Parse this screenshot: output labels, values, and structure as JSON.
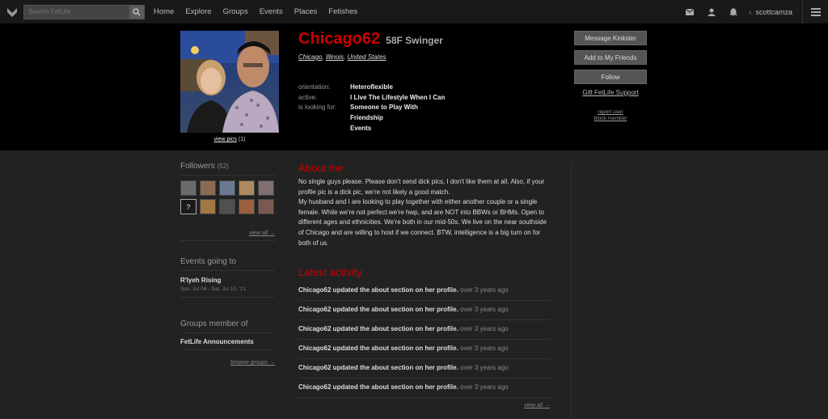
{
  "nav": {
    "search_placeholder": "Search FetLife",
    "links": [
      "Home",
      "Explore",
      "Groups",
      "Events",
      "Places",
      "Fetishes"
    ],
    "username": "scottcamza",
    "user_caret": "‹"
  },
  "profile": {
    "nickname": "Chicago62",
    "meta": "58F Swinger",
    "location": [
      "Chicago",
      "Illinois",
      "United States"
    ],
    "view_pics_label": "view pics",
    "pic_count": "(1)",
    "details": {
      "orientation_label": "orientation:",
      "orientation": "Heteroflexible",
      "active_label": "active:",
      "active": "I Live The Lifestyle When I Can",
      "looking_label": "is looking for:",
      "looking": [
        "Someone to Play With",
        "Friendship",
        "Events"
      ]
    },
    "actions": {
      "message": "Message Kinkster",
      "add_friend": "Add to My Friends",
      "follow": "Follow",
      "gift": "Gift FetLife Support",
      "report": "report user",
      "block": "block member"
    }
  },
  "sidebar": {
    "followers_title": "Followers",
    "followers_count": "(52)",
    "follower_thumb_colors": [
      "#6a6a6a",
      "#8a6a50",
      "#6a7a90",
      "#b08860",
      "#807070",
      "#1a1a1a",
      "#a07840",
      "#505050",
      "#9a6040",
      "#7a5a50"
    ],
    "followers_view_all": "view all →",
    "events_title": "Events going to",
    "event_name": "R'lyeh Rising",
    "event_date": "Sun, Jul 04 - Sat, Jul 10, '21",
    "groups_title": "Groups member of",
    "group_name": "FetLife Announcements",
    "browse_groups": "browse groups →"
  },
  "about": {
    "title": "About me",
    "text": "No single guys please. Please don't send dick pics, I don't like them at all. Also, if your profile pic is a dick pic, we're not likely a good match.\nMy husband and I are looking to play together with either another couple or a single female. While we're not perfect we're hwp, and are NOT into BBWs or BHMs. Open to different ages and ethnicities. We're both in our mid-50s. We live on the near southside of Chicago and are willing to host if we connect. BTW, intelligence is a big turn on for both of us."
  },
  "activity": {
    "title": "Latest activity",
    "items": [
      {
        "text": "Chicago62 updated the about section on her profile.",
        "time": "over 3 years ago"
      },
      {
        "text": "Chicago62 updated the about section on her profile.",
        "time": "over 3 years ago"
      },
      {
        "text": "Chicago62 updated the about section on her profile.",
        "time": "over 3 years ago"
      },
      {
        "text": "Chicago62 updated the about section on her profile.",
        "time": "over 3 years ago"
      },
      {
        "text": "Chicago62 updated the about section on her profile.",
        "time": "over 3 years ago"
      },
      {
        "text": "Chicago62 updated the about section on her profile.",
        "time": "over 3 years ago"
      }
    ],
    "view_all": "view all →"
  },
  "colors": {
    "accent_red": "#cc0000",
    "nav_bg": "#191919",
    "header_bg": "#000000",
    "body_bg": "#222222"
  }
}
